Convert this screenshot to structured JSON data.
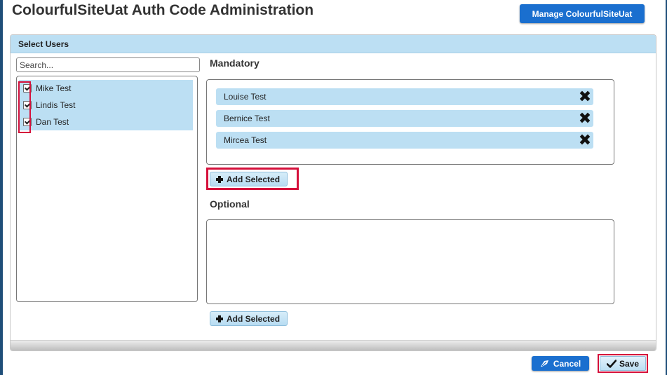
{
  "header": {
    "title": "ColourfulSiteUat Auth Code Administration",
    "manage_button": "Manage ColourfulSiteUat"
  },
  "panel": {
    "title": "Select Users"
  },
  "search": {
    "placeholder": "Search..."
  },
  "users": [
    {
      "name": "Mike Test",
      "checked": true
    },
    {
      "name": "Lindis Test",
      "checked": true
    },
    {
      "name": "Dan Test",
      "checked": true
    }
  ],
  "mandatory": {
    "title": "Mandatory",
    "selected": [
      {
        "name": "Louise Test"
      },
      {
        "name": "Bernice Test"
      },
      {
        "name": "Mircea Test"
      }
    ],
    "add_button": "Add Selected"
  },
  "optional": {
    "title": "Optional",
    "selected": [],
    "add_button": "Add Selected"
  },
  "footer": {
    "cancel_label": "Cancel",
    "save_label": "Save"
  },
  "colors": {
    "primary": "#1a6fcf",
    "highlight_row": "#bcdff3",
    "annotation_red": "#d5103b"
  },
  "icons": {
    "remove": "close-icon",
    "add": "plus-icon",
    "cancel": "cancel-icon",
    "save": "checkmark-icon"
  }
}
